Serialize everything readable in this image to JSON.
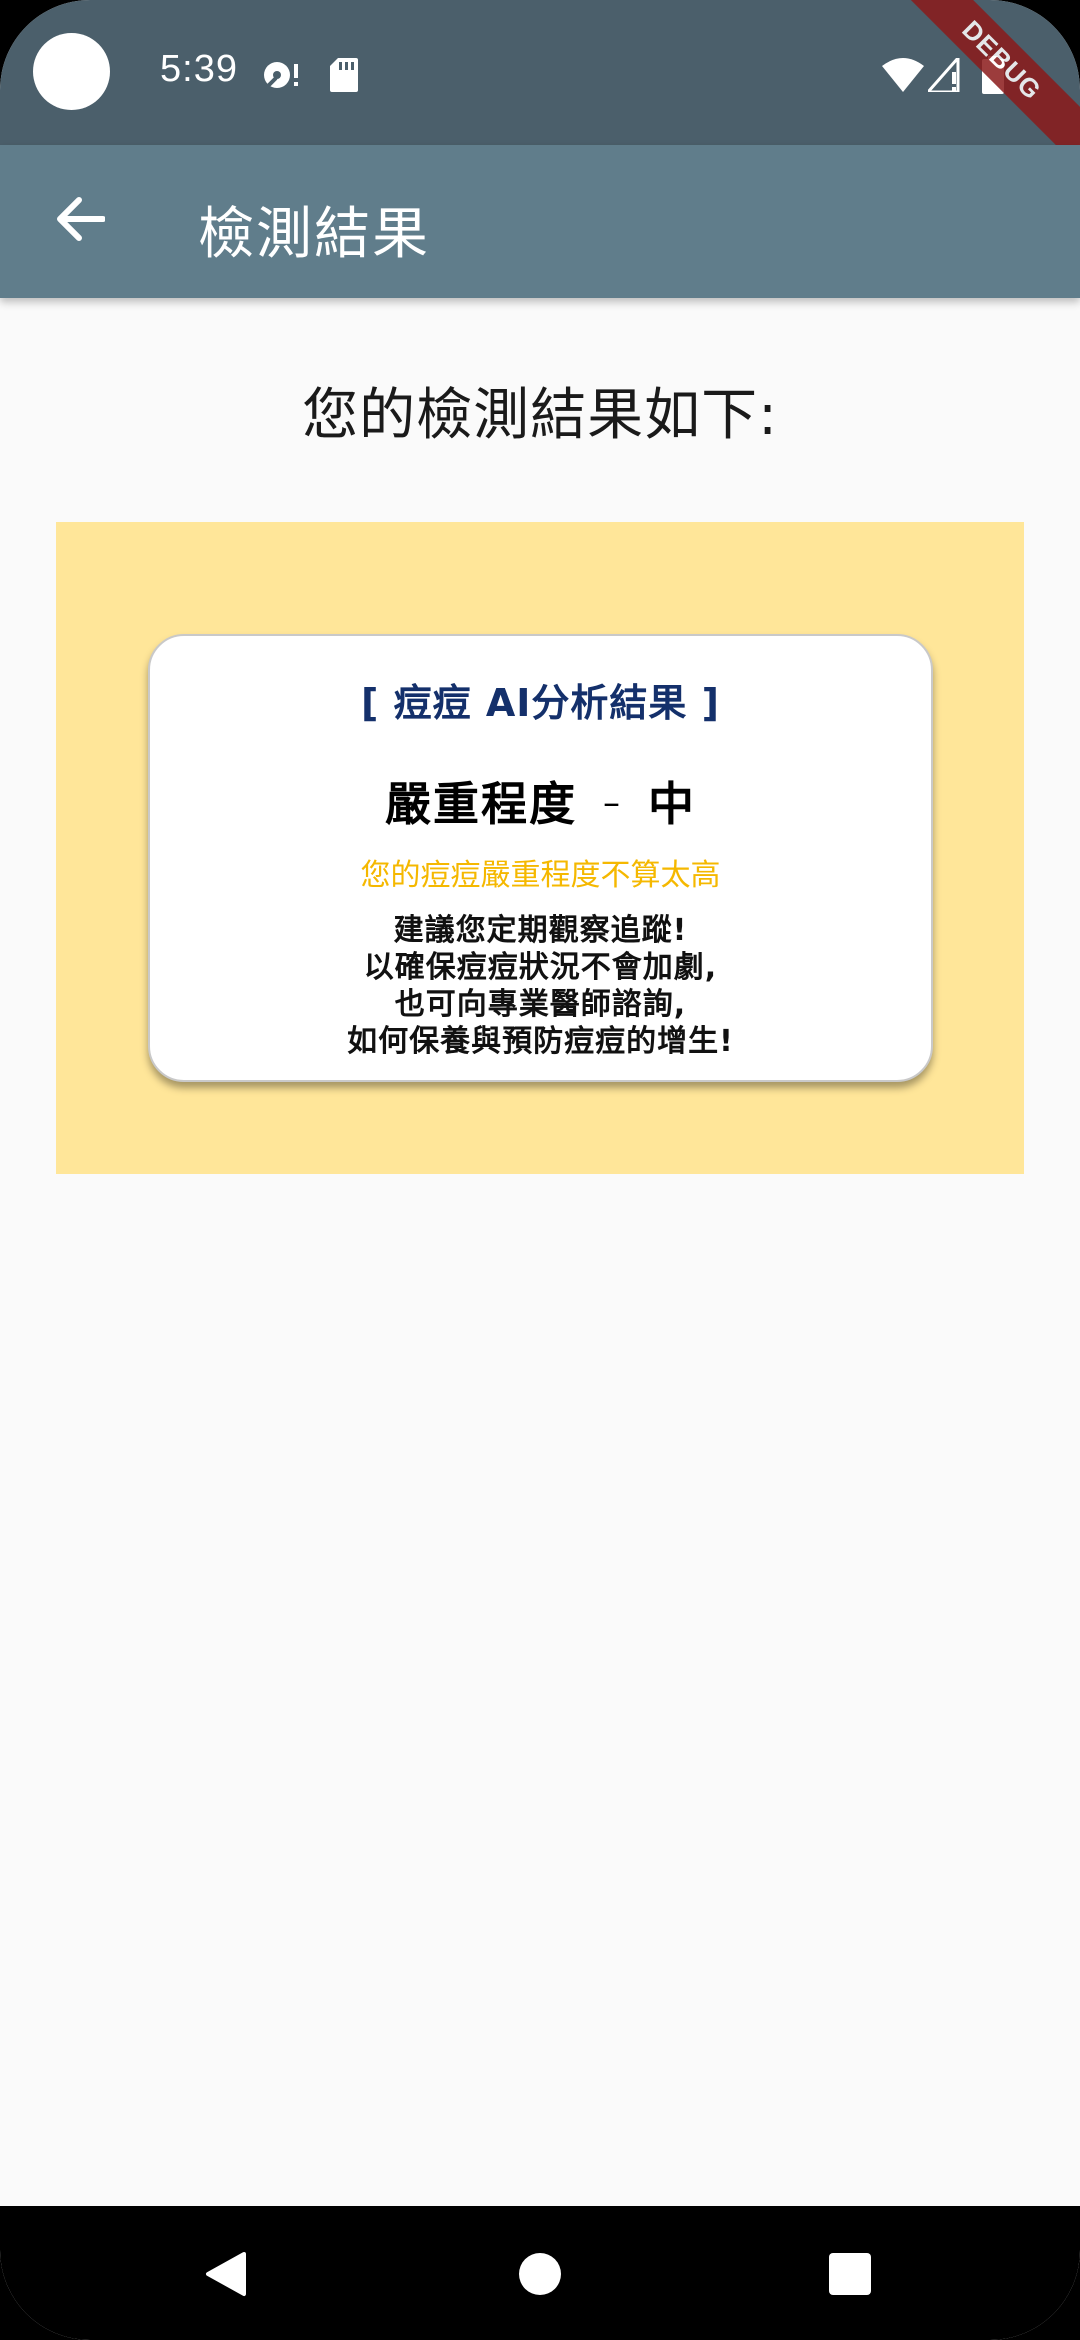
{
  "status_bar": {
    "time": "5:39",
    "icons": [
      "record-icon",
      "sd-card-icon",
      "wifi-icon",
      "signal-icon",
      "battery-icon"
    ],
    "debug_label": "DEBUG"
  },
  "app_bar": {
    "title": "檢測結果",
    "back_icon": "arrow-back-icon"
  },
  "main": {
    "heading": "您的檢測結果如下:",
    "panel_color": "#ffe699",
    "card": {
      "title": "[ 痘痘 AI分析結果 ]",
      "severity_label": "嚴重程度",
      "severity_separator": "–",
      "severity_value": "中",
      "note": "您的痘痘嚴重程度不算太高",
      "advice": [
        "建議您定期觀察追蹤!",
        "以確保痘痘狀況不會加劇,",
        "也可向專業醫師諮詢,",
        "如何保養與預防痘痘的增生!"
      ]
    }
  },
  "colors": {
    "status_bar": "#4b5f6b",
    "app_bar": "#607d8b",
    "card_title": "#14306b",
    "note": "#f5b800"
  },
  "nav_bar": {
    "buttons": [
      "back-triangle-icon",
      "home-circle-icon",
      "recents-square-icon"
    ]
  }
}
